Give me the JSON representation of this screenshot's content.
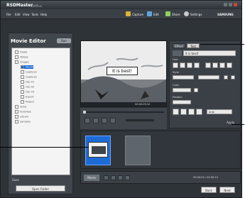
{
  "app": {
    "title": "RSDMaster",
    "title_suffix": "SoftPlus",
    "menu": [
      "File",
      "Edit",
      "View",
      "Tools",
      "Help"
    ],
    "toolbar_items": [
      "Capture",
      "Edit",
      "Share",
      "Settings"
    ],
    "brand_right": "SAMSUNG"
  },
  "sidebar": {
    "title": "Movie Editor",
    "badge": "Run",
    "tree_items": [
      "Folder",
      "Videos",
      "Images",
      "Album",
      "Capture1",
      "Capture2",
      "Clip 01",
      "Clip 02",
      "Clip 03",
      "Export",
      "Project",
      "Temp",
      "Favorites",
      "Library",
      "Samples"
    ],
    "bottom_label": "Save",
    "bottom_button": "Open Folder"
  },
  "preview": {
    "caption": "It is best!",
    "timecode": "00:00:05:10"
  },
  "properties": {
    "tabs": [
      "Effect",
      "Text"
    ],
    "caption_value": "It is best!",
    "section_labels": [
      "Font",
      "Style",
      "Color",
      "Position"
    ],
    "font_value": "Arial",
    "apply_label": "Apply"
  },
  "timeline": {
    "tab": "Movie",
    "status": "00:00:00 / 00:00:10",
    "buttons": [
      "Back",
      "Next"
    ]
  },
  "colors": {
    "window_bg": "#2e3338",
    "panel_bg": "#3a4046",
    "highlight": "#1e6bd6"
  }
}
